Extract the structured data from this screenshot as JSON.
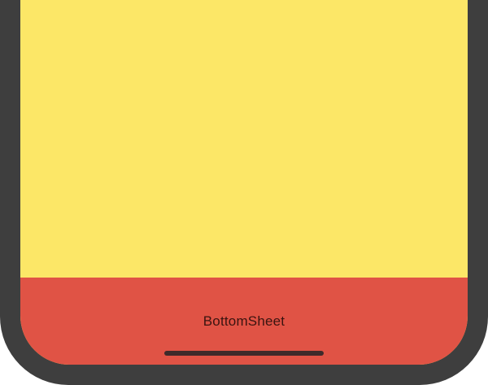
{
  "colors": {
    "frame": "#3e3e3e",
    "main_background": "#fce767",
    "bottom_sheet_background": "#e05345",
    "bottom_sheet_text": "#3a1410",
    "home_indicator": "#3e2a2a"
  },
  "bottom_sheet": {
    "label": "BottomSheet"
  }
}
